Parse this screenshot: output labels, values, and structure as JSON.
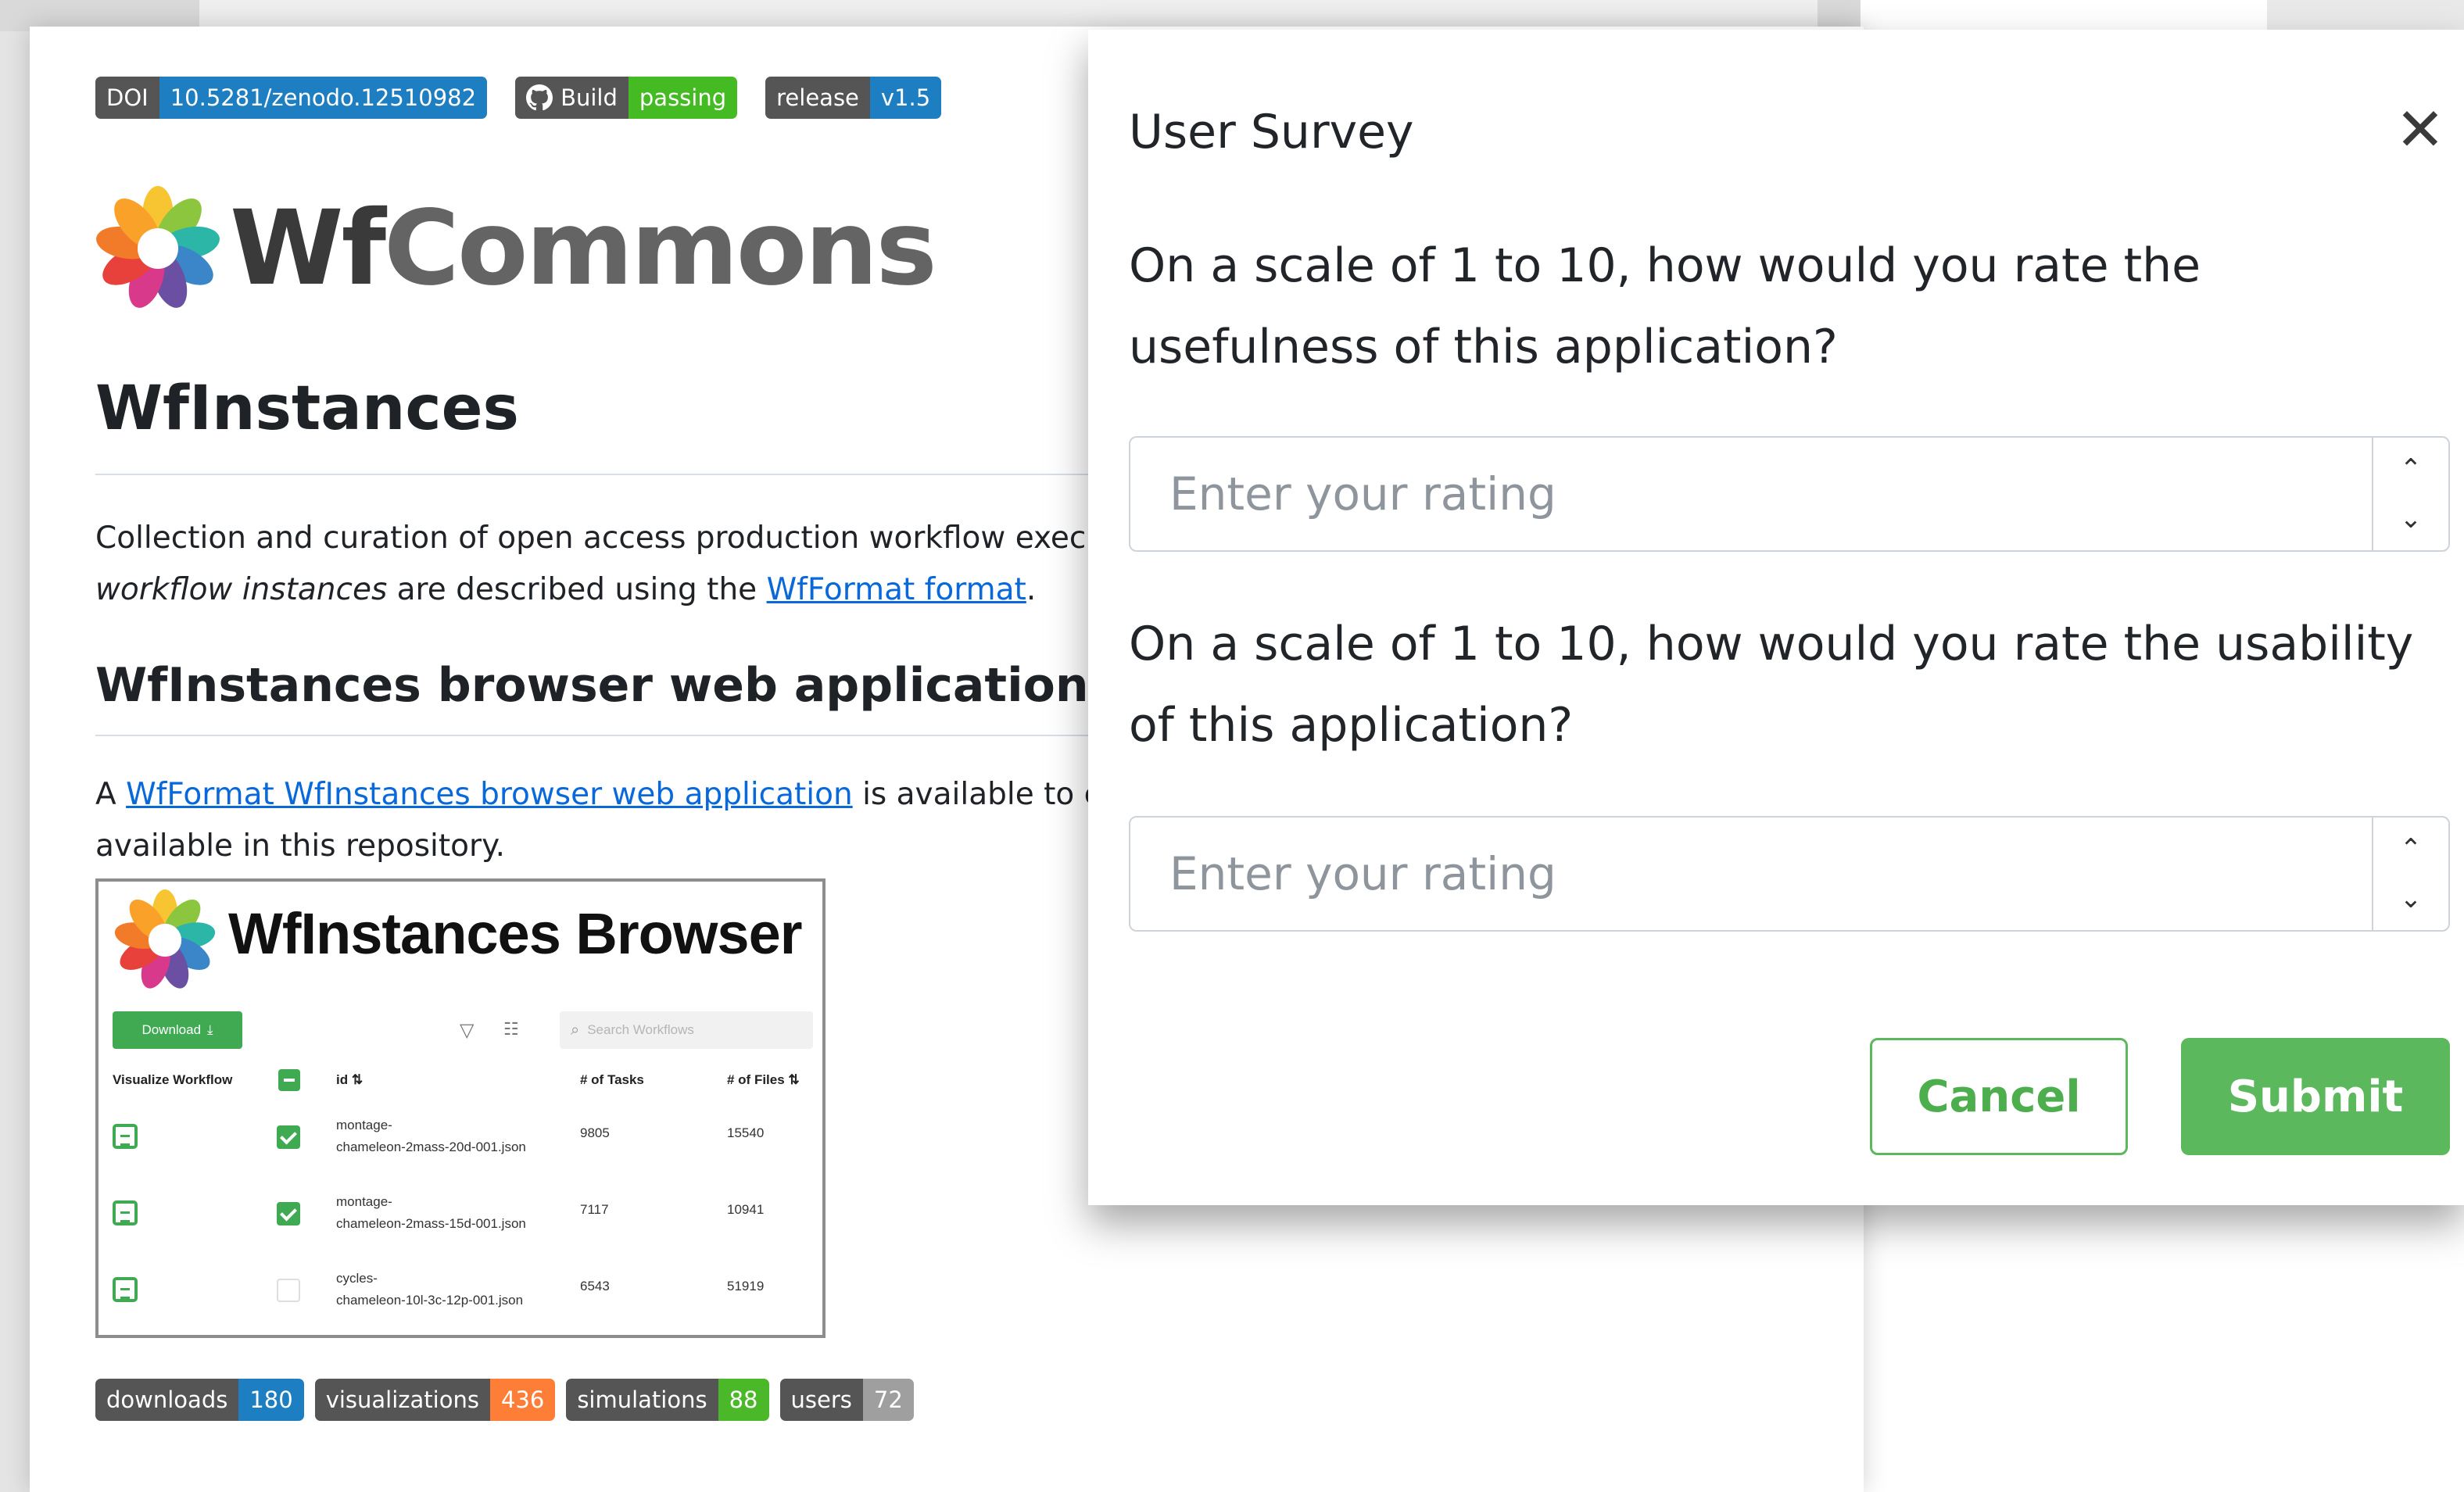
{
  "readme": {
    "badges_top": [
      {
        "left": "DOI",
        "right": "10.5281/zenodo.12510982",
        "right_color": "#1e7ec2"
      },
      {
        "left": "Build",
        "right": "passing",
        "right_color": "#44bb22",
        "icon": "github-icon"
      },
      {
        "left": "release",
        "right": "v1.5",
        "right_color": "#1e7ec2"
      }
    ],
    "logo": {
      "wf": "Wf",
      "commons": "Commons",
      "icon": "flower-logo-icon"
    },
    "title": "WfInstances",
    "intro": {
      "line1": "Collection and curation of open access production workflow executi",
      "line2_em": "workflow instances",
      "line2_mid": " are described using the ",
      "line2_link": "WfFormat format",
      "line2_end": "."
    },
    "subtitle": "WfInstances browser web application",
    "para2": {
      "pre": "A ",
      "link": "WfFormat WfInstances browser web application",
      "post": " is available to eas",
      "line2": "available in this repository."
    },
    "screenshot": {
      "title": "WfInstances Browser",
      "download_label": "Download",
      "search_placeholder": "Search Workflows",
      "headers": {
        "visualize": "Visualize Workflow",
        "id": "id ⇅",
        "tasks": "# of Tasks",
        "files": "# of Files ⇅"
      },
      "rows": [
        {
          "id_1": "montage-",
          "id_2": "chameleon-2mass-20d-001.json",
          "tasks": "9805",
          "files": "15540",
          "checked": true
        },
        {
          "id_1": "montage-",
          "id_2": "chameleon-2mass-15d-001.json",
          "tasks": "7117",
          "files": "10941",
          "checked": true
        },
        {
          "id_1": "cycles-",
          "id_2": "chameleon-10l-3c-12p-001.json",
          "tasks": "6543",
          "files": "51919",
          "checked": false
        }
      ]
    },
    "badges_bottom": [
      {
        "left": "downloads",
        "right": "180",
        "right_color": "#1e7ec2"
      },
      {
        "left": "visualizations",
        "right": "436",
        "right_color": "#fe7d37"
      },
      {
        "left": "simulations",
        "right": "88",
        "right_color": "#4ab828"
      },
      {
        "left": "users",
        "right": "72",
        "right_color": "#9f9f9f"
      }
    ]
  },
  "modal": {
    "title": "User Survey",
    "close_icon": "close-icon",
    "question_1": "On a scale of 1 to 10, how would you rate the usefulness of this application?",
    "question_2": "On a scale of 1 to 10, how would you rate the usability of this application?",
    "rating_placeholder": "Enter your rating",
    "cancel_label": "Cancel",
    "submit_label": "Submit",
    "accent_color": "#5cb85c"
  }
}
